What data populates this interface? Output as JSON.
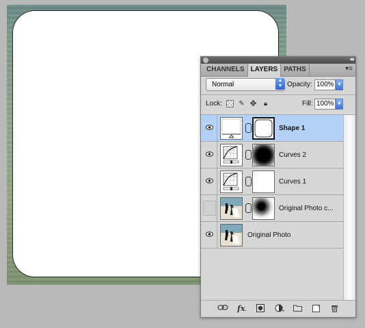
{
  "panel": {
    "tabs": [
      {
        "label": "CHANNELS",
        "active": false
      },
      {
        "label": "LAYERS",
        "active": true
      },
      {
        "label": "PATHS",
        "active": false
      }
    ],
    "menu_icon": "panel-menu-icon",
    "blend_mode": "Normal",
    "opacity_label": "Opacity:",
    "opacity_value": "100%",
    "lock_label": "Lock:",
    "fill_label": "Fill:",
    "fill_value": "100%"
  },
  "layers": [
    {
      "name": "Shape 1",
      "visible": true,
      "selected": true,
      "type": "shape"
    },
    {
      "name": "Curves 2",
      "visible": true,
      "selected": false,
      "type": "adjustment"
    },
    {
      "name": "Curves 1",
      "visible": true,
      "selected": false,
      "type": "adjustment"
    },
    {
      "name": "Original Photo c...",
      "visible": false,
      "selected": false,
      "type": "photo-masked"
    },
    {
      "name": "Original Photo",
      "visible": true,
      "selected": false,
      "type": "photo"
    }
  ],
  "bottom_icons": [
    "link-layers-icon",
    "fx-icon",
    "add-mask-icon",
    "adjustment-layer-icon",
    "group-folder-icon",
    "new-layer-icon",
    "trash-icon"
  ],
  "colors": {
    "selection": "#b4d1f7",
    "accent": "#2c65d2",
    "panel_bg": "#d6d6d6"
  }
}
